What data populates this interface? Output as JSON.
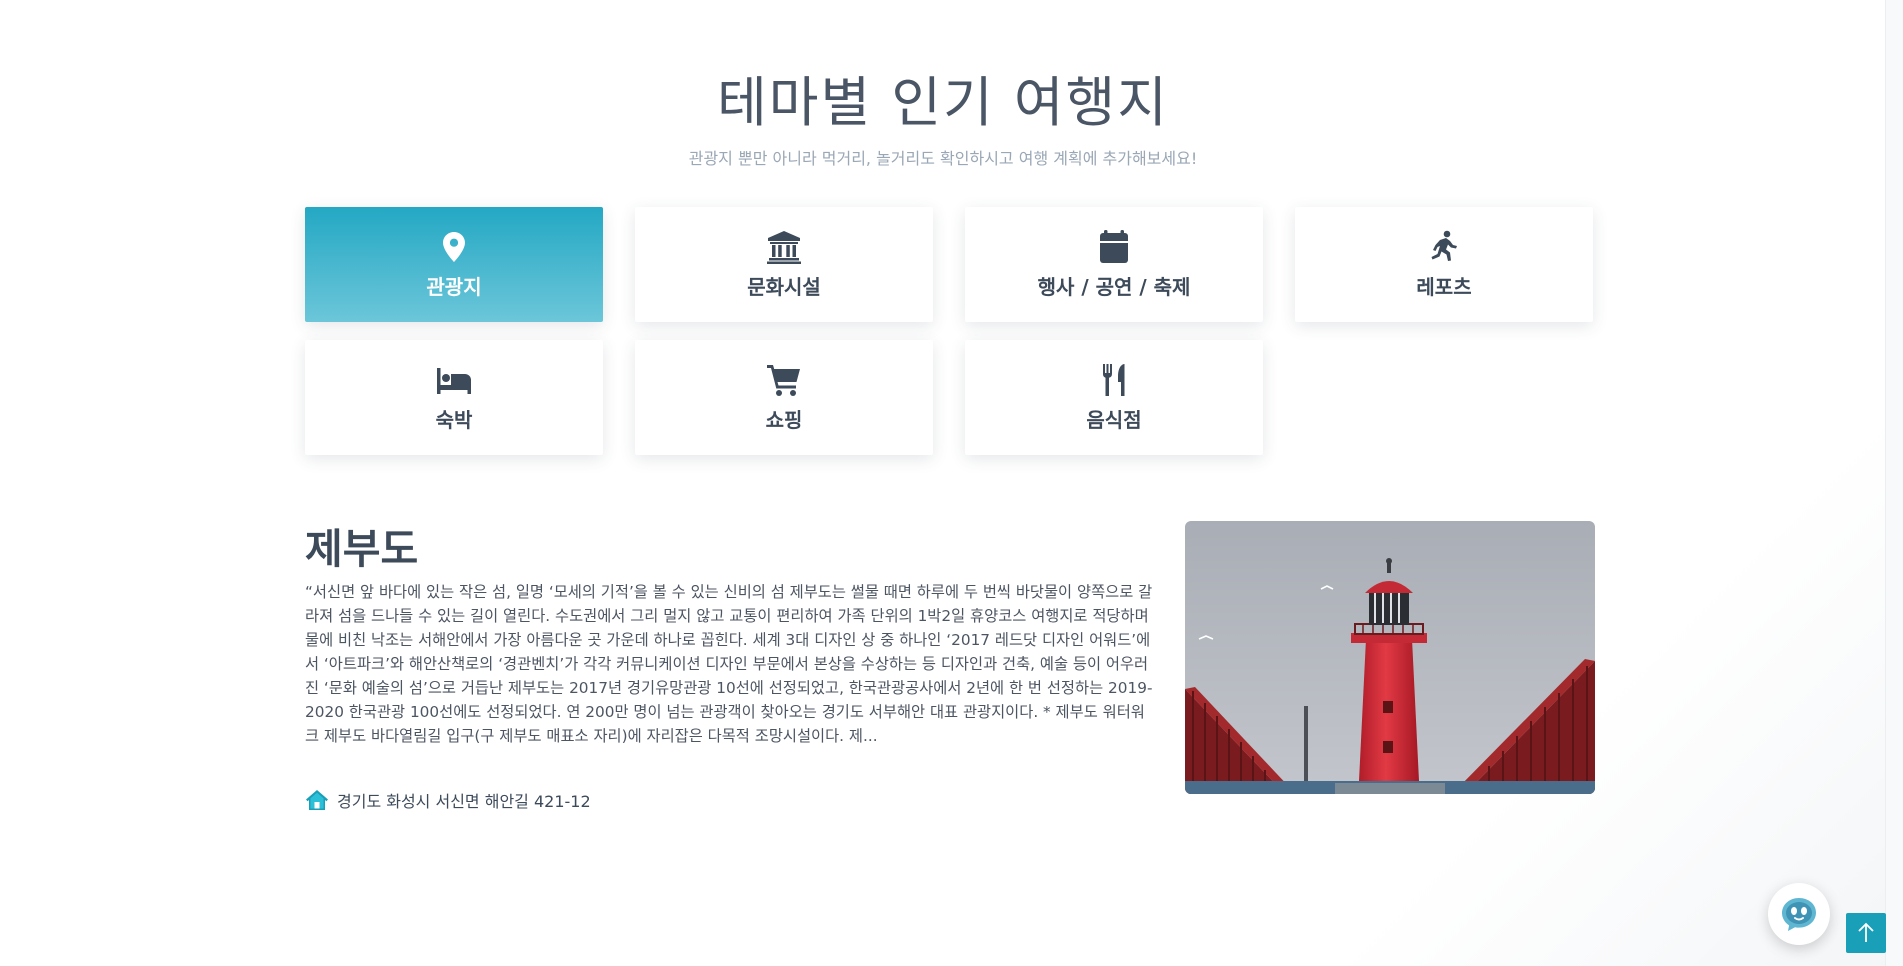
{
  "section": {
    "title": "테마별 인기 여행지",
    "subtitle": "관광지 뿐만 아니라 먹거리, 놀거리도 확인하시고 여행 계획에 추가해보세요!"
  },
  "themes": [
    {
      "label": "관광지",
      "icon": "map-pin-icon",
      "active": true
    },
    {
      "label": "문화시설",
      "icon": "museum-icon",
      "active": false
    },
    {
      "label": "행사 / 공연 / 축제",
      "icon": "calendar-icon",
      "active": false
    },
    {
      "label": "레포츠",
      "icon": "running-icon",
      "active": false
    },
    {
      "label": "숙박",
      "icon": "bed-icon",
      "active": false
    },
    {
      "label": "쇼핑",
      "icon": "cart-icon",
      "active": false
    },
    {
      "label": "음식점",
      "icon": "utensils-icon",
      "active": false
    }
  ],
  "feature": {
    "title": "제부도",
    "description": "“서신면 앞 바다에 있는 작은 섬, 일명 ‘모세의 기적’을 볼 수 있는 신비의 섬 제부도는 썰물 때면 하루에 두 번씩 바닷물이 양쪽으로 갈라져 섬을 드나들 수 있는 길이 열린다. 수도권에서 그리 멀지 않고 교통이 편리하여 가족 단위의 1박2일 휴양코스 여행지로 적당하며 물에 비친 낙조는 서해안에서 가장 아름다운 곳 가운데 하나로 꼽힌다. 세계 3대 디자인 상 중 하나인 ‘2017 레드닷 디자인 어워드’에서 ‘아트파크’와 해안산책로의 ‘경관벤치’가 각각 커뮤니케이션 디자인 부문에서 본상을 수상하는 등 디자인과 건축, 예술 등이 어우러진 ‘문화 예술의 섬’으로 거듭난 제부도는 2017년 경기유망관광 10선에 선정되었고, 한국관광공사에서 2년에 한 번 선정하는 2019-2020 한국관광 100선에도 선정되었다. 연 200만 명이 넘는 관광객이 찾아오는 경기도 서부해안 대표 관광지이다. * 제부도 워터워크 제부도 바다열림길 입구(구 제부도 매표소 자리)에 자리잡은 다목적 조망시설이다. 제...",
    "address": "경기도 화성시 서신면 해안길 421-12",
    "image_icon": "lighthouse-photo"
  },
  "floating": {
    "chat_icon": "chatbot-icon",
    "top_icon": "arrow-up-icon"
  },
  "colors": {
    "accent": "#24a8c4",
    "accent_light": "#6cc6d9",
    "text": "#3d4a5a",
    "muted": "#9aa7b5",
    "top_button": "#1a9fb8"
  }
}
